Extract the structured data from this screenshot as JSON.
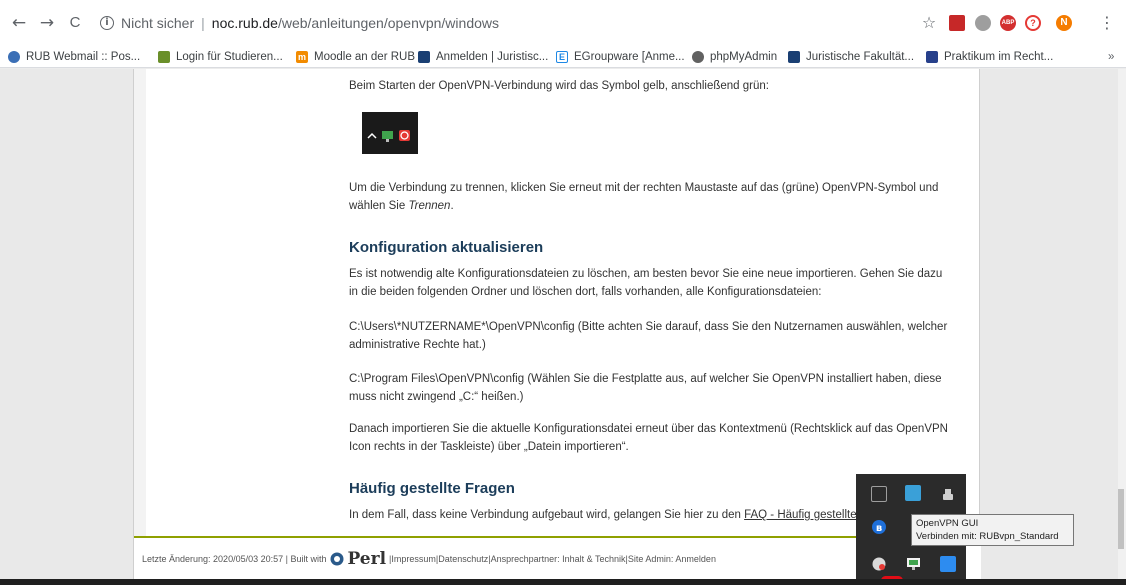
{
  "browser": {
    "back_glyph": "←",
    "forward_glyph": "→",
    "reload_glyph": "C",
    "security_label": "Nicht sicher",
    "url_host": "noc.rub.de",
    "url_path": "/web/anleitungen/openvpn/windows",
    "star_glyph": "☆",
    "menu_glyph": "⋮",
    "profile_initial": "N",
    "bookmarks_more": "»",
    "bookmarks": [
      {
        "label": "RUB Webmail :: Pos...",
        "icon": "webmail-icon"
      },
      {
        "label": "Login für Studieren...",
        "icon": "campus-icon"
      },
      {
        "label": "Moodle an der RUB",
        "icon": "moodle-icon"
      },
      {
        "label": "Anmelden | Juristisc...",
        "icon": "law-faculty-icon"
      },
      {
        "label": "EGroupware [Anme...",
        "icon": "egroupware-icon"
      },
      {
        "label": "phpMyAdmin",
        "icon": "phpmyadmin-icon"
      },
      {
        "label": "Juristische Fakultät...",
        "icon": "law-faculty-icon"
      },
      {
        "label": "Praktikum im Recht...",
        "icon": "praktikum-icon"
      }
    ]
  },
  "article": {
    "p_start": "Beim Starten der OpenVPN-Verbindung wird das Symbol gelb, anschließend grün:",
    "p_disconnect_a": "Um die Verbindung zu trennen, klicken Sie erneut mit der rechten Maustaste auf das (grüne) OpenVPN-Symbol und wählen Sie ",
    "p_disconnect_em": "Trennen",
    "p_disconnect_b": ".",
    "h_config": "Konfiguration aktualisieren",
    "p_config": "Es ist notwendig alte Konfigurationsdateien zu löschen, am besten bevor Sie eine neue importieren. Gehen Sie dazu in die beiden folgenden Ordner und löschen dort, falls vorhanden, alle Konfigurationsdateien:",
    "p_path_user": "C:\\Users\\*NUTZERNAME*\\OpenVPN\\config (Bitte achten Sie darauf, dass Sie den Nutzernamen auswählen, welcher administrative Rechte hat.)",
    "p_path_program": "C:\\Program Files\\OpenVPN\\config (Wählen Sie die Festplatte aus, auf welcher Sie OpenVPN installiert haben, diese muss nicht zwingend „C:“ heißen.)",
    "p_import": "Danach importieren Sie die aktuelle Konfigurationsdatei erneut über das Kontextmenü (Rechtsklick auf das OpenVPN Icon rechts in der Taskleiste) über „Datein importieren“.",
    "h_faq": "Häufig gestellte Fragen",
    "p_faq_a": "In dem Fall, dass keine Verbindung aufgebaut wird, gelangen Sie hier zu den ",
    "p_faq_link": "FAQ - Häufig gestellte Fra"
  },
  "footer": {
    "last_change": "Letzte Änderung: 2020/05/03 20:57 | Built with",
    "perl": "Perl",
    "impressum": "Impressum",
    "datenschutz": "Datenschutz",
    "ansprechpartner": "Ansprechpartner: Inhalt & Technik",
    "site_admin": "Site Admin: Anmelden",
    "sep": " | "
  },
  "tray_tooltip": {
    "line1": "OpenVPN GUI",
    "line2": "Verbinden mit: RUBvpn_Standard"
  },
  "colors": {
    "heading": "#1c3d5a",
    "footer_rule": "#8fa000",
    "tray_bg": "#2b2b2b"
  }
}
